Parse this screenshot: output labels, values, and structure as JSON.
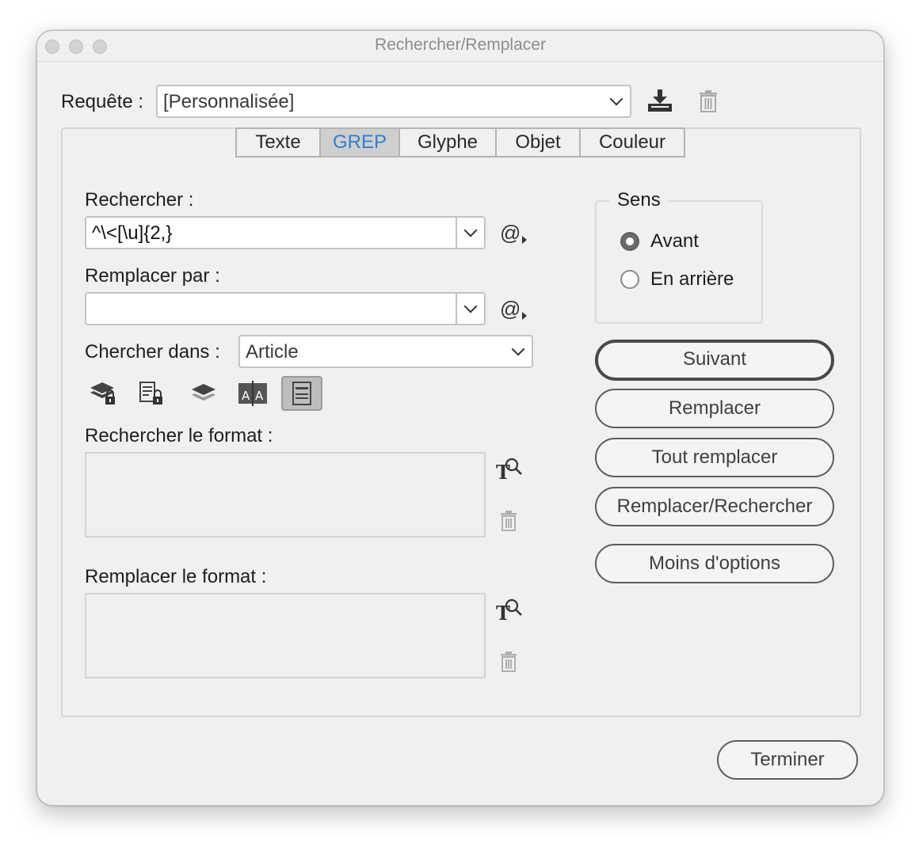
{
  "window": {
    "title": "Rechercher/Remplacer"
  },
  "query": {
    "label": "Requête :",
    "value": "[Personnalisée]"
  },
  "tabs": [
    {
      "label": "Texte",
      "active": false
    },
    {
      "label": "GREP",
      "active": true
    },
    {
      "label": "Glyphe",
      "active": false
    },
    {
      "label": "Objet",
      "active": false
    },
    {
      "label": "Couleur",
      "active": false
    }
  ],
  "search": {
    "label": "Rechercher :",
    "value": "^\\<[\\u]{2,}"
  },
  "replace": {
    "label": "Remplacer par :",
    "value": ""
  },
  "scope": {
    "label": "Chercher dans :",
    "value": "Article"
  },
  "find_format": {
    "label": "Rechercher le format :"
  },
  "replace_format": {
    "label": "Remplacer le format :"
  },
  "direction": {
    "title": "Sens",
    "options": [
      {
        "label": "Avant",
        "selected": true
      },
      {
        "label": "En arrière",
        "selected": false
      }
    ]
  },
  "actions": {
    "next": "Suivant",
    "replace": "Remplacer",
    "replace_all": "Tout remplacer",
    "replace_find": "Remplacer/Rechercher",
    "fewer_options": "Moins d'options",
    "done": "Terminer"
  },
  "option_icons": [
    "locked-layers-icon",
    "locked-stories-icon",
    "hidden-layers-icon",
    "case-sensitive-icon",
    "master-pages-icon"
  ],
  "colors": {
    "accent": "#2f7fd1",
    "window_bg": "#f0f0f0"
  }
}
